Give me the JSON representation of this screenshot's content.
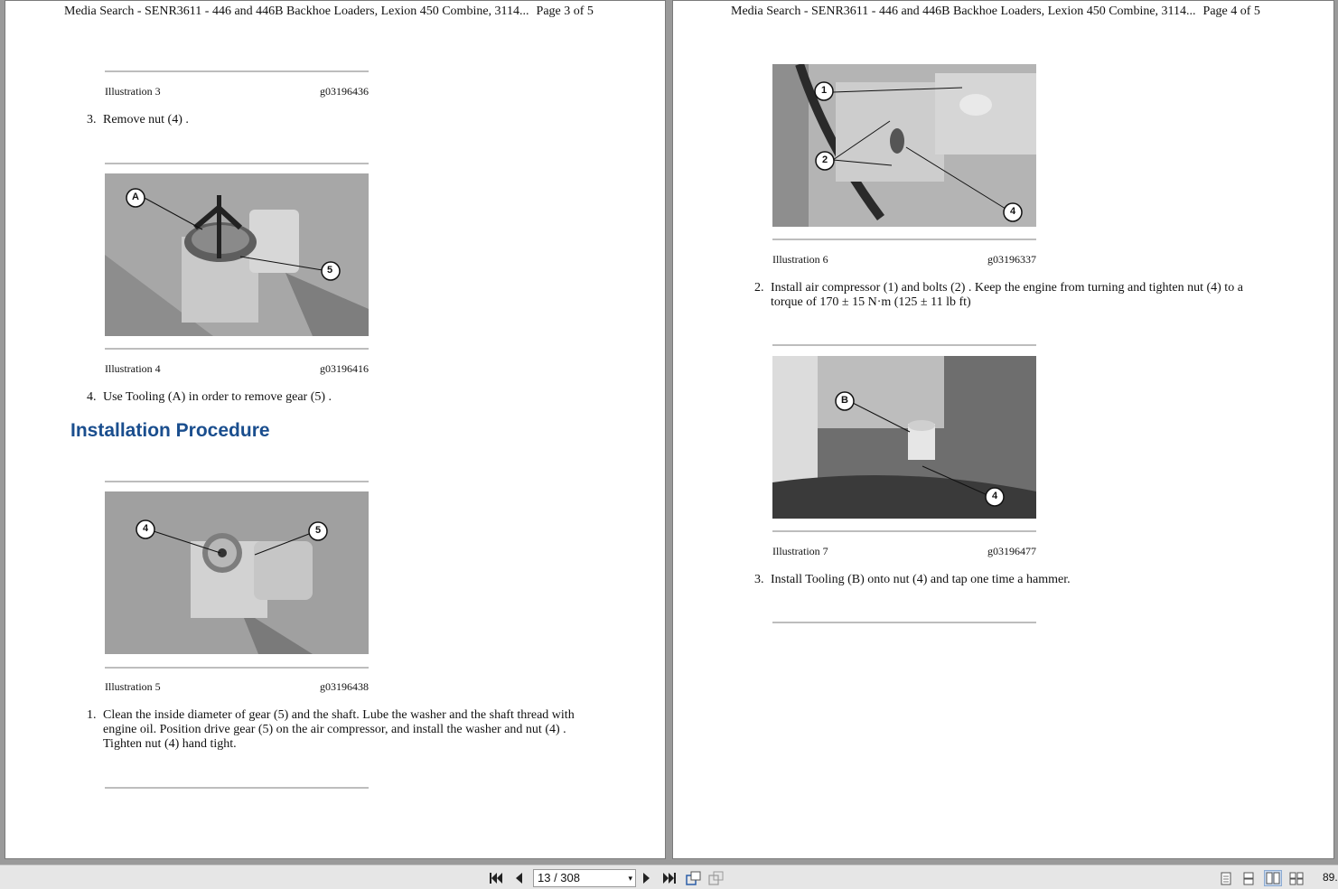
{
  "left_page": {
    "header_title": "Media Search - SENR3611 - 446 and 446B Backhoe Loaders, Lexion 450 Combine, 3114...",
    "header_page": "Page 3 of 5",
    "illustration_3": {
      "label": "Illustration 3",
      "code": "g03196436"
    },
    "step_3": {
      "num": "3.",
      "text": "Remove nut (4) ."
    },
    "illustration_4": {
      "label": "Illustration 4",
      "code": "g03196416",
      "callouts": [
        "A",
        "5"
      ]
    },
    "step_4": {
      "num": "4.",
      "text": "Use Tooling (A) in order to remove gear (5) ."
    },
    "section_heading": "Installation Procedure",
    "illustration_5": {
      "label": "Illustration 5",
      "code": "g03196438",
      "callouts": [
        "4",
        "5"
      ]
    },
    "step_1": {
      "num": "1.",
      "line1": "Clean the inside diameter of gear (5) and the shaft. Lube the washer and the shaft thread with",
      "line2": "engine oil. Position drive gear (5) on the air compressor, and install the washer and nut (4) .",
      "line3": "Tighten nut (4) hand tight."
    }
  },
  "right_page": {
    "header_title": "Media Search - SENR3611 - 446 and 446B Backhoe Loaders, Lexion 450 Combine, 3114...",
    "header_page": "Page 4 of 5",
    "illustration_6": {
      "label": "Illustration 6",
      "code": "g03196337",
      "callouts": [
        "1",
        "2",
        "4"
      ]
    },
    "step_2": {
      "num": "2.",
      "line1": "Install air compressor (1) and bolts (2) . Keep the engine from turning and tighten nut (4) to a",
      "line2": "torque of 170 ± 15 N·m (125 ± 11 lb ft)"
    },
    "illustration_7": {
      "label": "Illustration 7",
      "code": "g03196477",
      "callouts": [
        "B",
        "4"
      ]
    },
    "step_3": {
      "num": "3.",
      "text": "Install Tooling (B) onto nut (4) and tap one time a hammer."
    }
  },
  "toolbar": {
    "page_indicator": "13 / 308",
    "zoom": "89.",
    "icons": [
      "first-page-icon",
      "previous-page-icon",
      "next-page-icon",
      "last-page-icon",
      "rotate-icon",
      "fit-icon",
      "single-page-icon",
      "continuous-icon",
      "two-page-icon",
      "two-page-continuous-icon"
    ]
  }
}
